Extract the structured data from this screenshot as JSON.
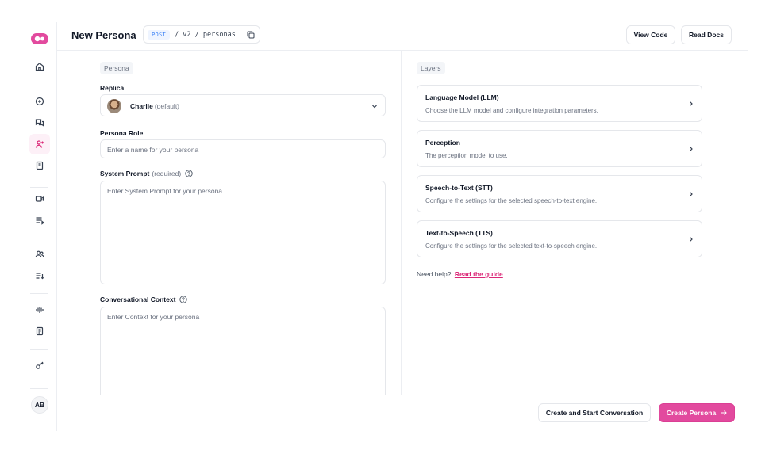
{
  "colors": {
    "accent": "#e24a9e",
    "link": "#db2777",
    "method": "#3b82f6"
  },
  "sidebar": {
    "logo_icon": "tavus-logo-icon",
    "items": [
      {
        "name": "home",
        "icon": "home-icon"
      },
      {
        "name": "create-conversation",
        "icon": "chat-plus-icon"
      },
      {
        "name": "conversations",
        "icon": "chat-bubbles-icon"
      },
      {
        "name": "personas",
        "icon": "user-plus-icon",
        "active": true
      },
      {
        "name": "library",
        "icon": "book-icon"
      },
      {
        "name": "videos",
        "icon": "video-icon"
      },
      {
        "name": "video-list",
        "icon": "list-icon"
      },
      {
        "name": "replicas",
        "icon": "users-icon"
      },
      {
        "name": "replica-list",
        "icon": "list-sort-icon"
      },
      {
        "name": "audio",
        "icon": "waveform-icon"
      },
      {
        "name": "documents",
        "icon": "document-icon"
      },
      {
        "name": "api-keys",
        "icon": "key-icon"
      }
    ],
    "avatar_initials": "AB"
  },
  "header": {
    "title": "New Persona",
    "method": "POST",
    "path": "/ v2 / personas",
    "view_code": "View Code",
    "read_docs": "Read Docs"
  },
  "form": {
    "section_label": "Persona",
    "replica": {
      "label": "Replica",
      "name": "Charlie",
      "note": "(default)"
    },
    "role": {
      "label": "Persona Role",
      "placeholder": "Enter a name for your persona"
    },
    "system_prompt": {
      "label": "System Prompt",
      "note": "(required)",
      "placeholder": "Enter System Prompt for your persona"
    },
    "context": {
      "label": "Conversational Context",
      "placeholder": "Enter Context for your persona"
    }
  },
  "layers": {
    "section_label": "Layers",
    "items": [
      {
        "title": "Language Model (LLM)",
        "desc": "Choose the LLM model and configure integration parameters."
      },
      {
        "title": "Perception",
        "desc": "The perception model to use."
      },
      {
        "title": "Speech-to-Text (STT)",
        "desc": "Configure the settings for the selected speech-to-text engine."
      },
      {
        "title": "Text-to-Speech (TTS)",
        "desc": "Configure the settings for the selected text-to-speech engine."
      }
    ],
    "help_text": "Need help?",
    "guide_link": "Read the guide"
  },
  "footer": {
    "secondary": "Create and Start Conversation",
    "primary": "Create Persona"
  }
}
